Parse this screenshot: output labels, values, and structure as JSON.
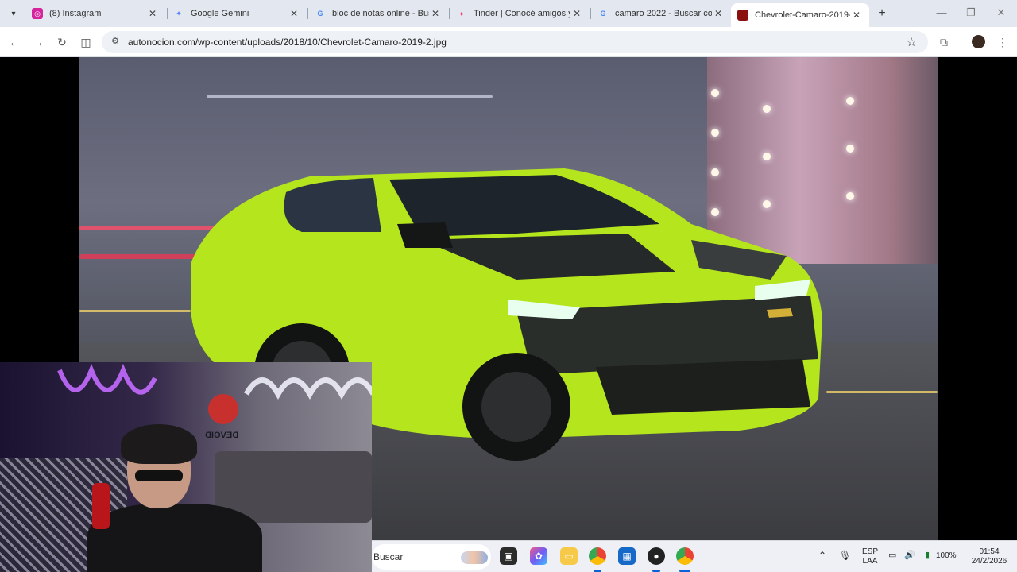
{
  "browser": {
    "tabs": [
      {
        "title": "(8) Instagram",
        "favicon": "instagram-icon",
        "color": "#d6249f"
      },
      {
        "title": "Google Gemini",
        "favicon": "gemini-icon",
        "color": "#4f7cf7"
      },
      {
        "title": "bloc de notas online - Busc",
        "favicon": "google-icon",
        "color": "#4285f4"
      },
      {
        "title": "Tinder | Conocé amigos y c",
        "favicon": "tinder-icon",
        "color": "#fe3c72"
      },
      {
        "title": "camaro 2022 - Buscar con",
        "favicon": "google-icon",
        "color": "#4285f4"
      },
      {
        "title": "Chevrolet-Camaro-2019-2",
        "favicon": "image-icon",
        "color": "#8b1111"
      }
    ],
    "url": "autonocion.com/wp-content/uploads/2018/10/Chevrolet-Camaro-2019-2.jpg"
  },
  "webcam": {
    "sign_text": "DEVOID"
  },
  "taskbar": {
    "search_label": "Buscar",
    "language": "ESP",
    "keyboard_layout": "LAA",
    "battery": "100%",
    "time": "01:54",
    "date": "24/2/2026"
  }
}
